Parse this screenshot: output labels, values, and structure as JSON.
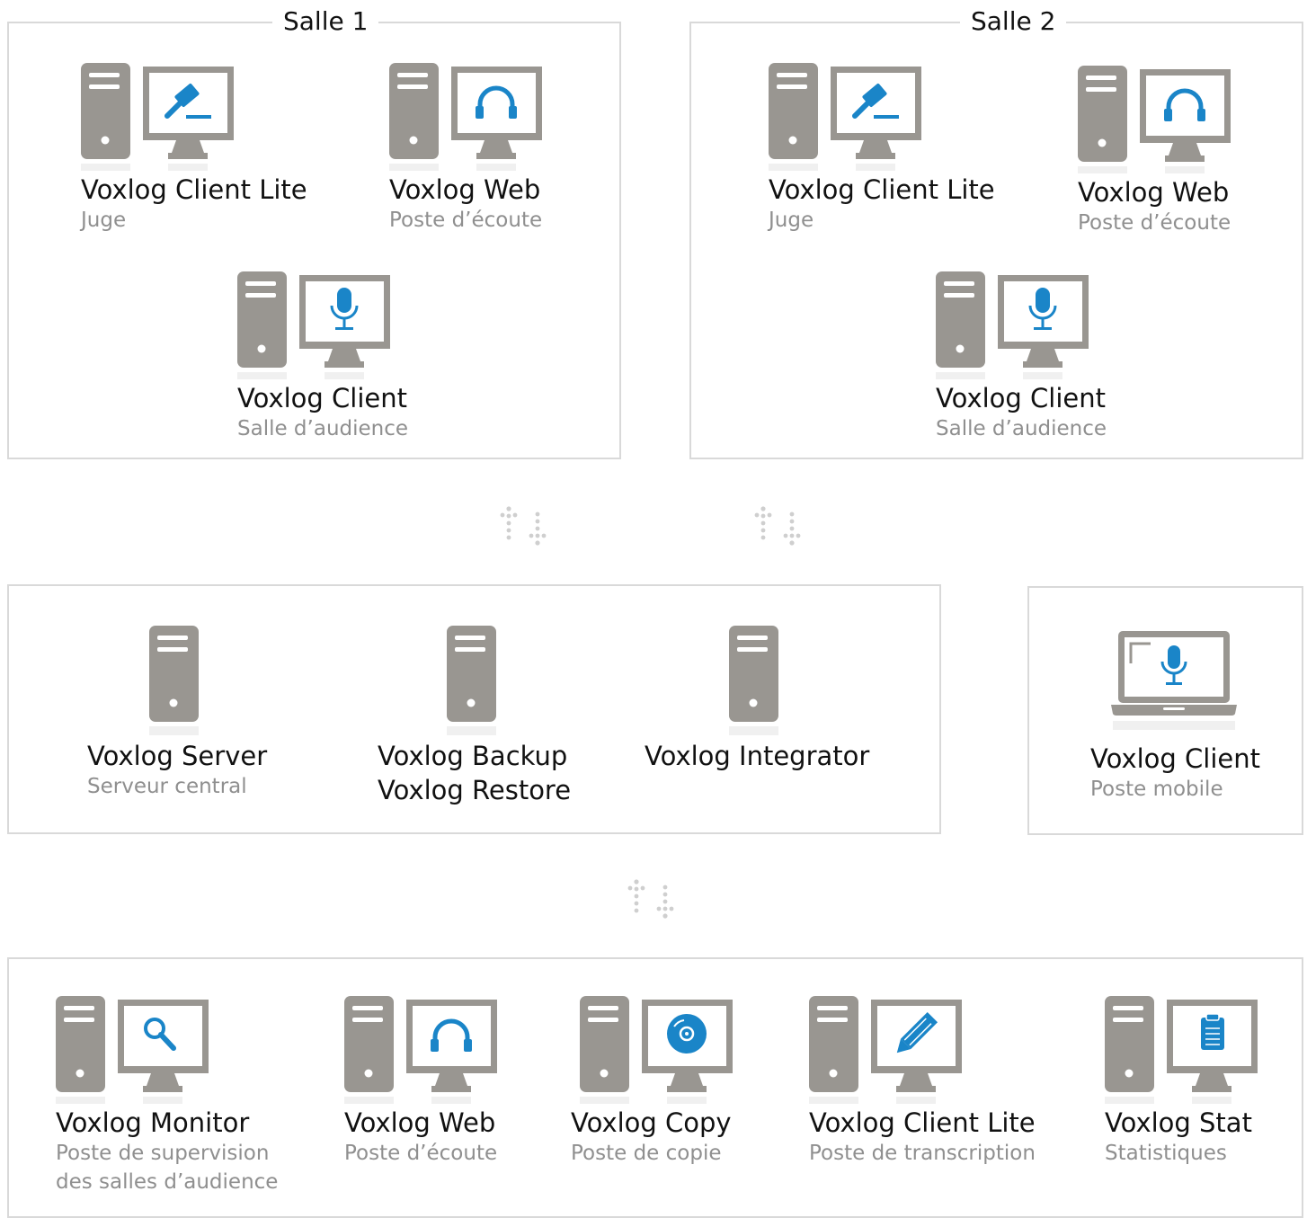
{
  "colors": {
    "device": "#999691",
    "accent": "#1a85c8",
    "border": "#d9d9d9",
    "reflection": "#f0f0f0"
  },
  "rooms": [
    {
      "title": "Salle 1"
    },
    {
      "title": "Salle 2"
    }
  ],
  "salle1": {
    "lite": {
      "name": "Voxlog Client Lite",
      "role": "Juge",
      "icon": "gavel-icon"
    },
    "web": {
      "name": "Voxlog Web",
      "role": "Poste d’écoute",
      "icon": "headphones-icon"
    },
    "client": {
      "name": "Voxlog Client",
      "role": "Salle d’audience",
      "icon": "microphone-icon"
    }
  },
  "salle2": {
    "lite": {
      "name": "Voxlog Client Lite",
      "role": "Juge",
      "icon": "gavel-icon"
    },
    "web": {
      "name": "Voxlog Web",
      "role": "Poste d’écoute",
      "icon": "headphones-icon"
    },
    "client": {
      "name": "Voxlog Client",
      "role": "Salle d’audience",
      "icon": "microphone-icon"
    }
  },
  "servers": {
    "server": {
      "name": "Voxlog Server",
      "role": "Serveur central"
    },
    "backup": {
      "name": "Voxlog Backup",
      "name2": "Voxlog Restore"
    },
    "integrator": {
      "name": "Voxlog Integrator"
    }
  },
  "mobile": {
    "name": "Voxlog Client",
    "role": "Poste mobile",
    "icon": "microphone-icon"
  },
  "bottom": {
    "monitor": {
      "name": "Voxlog Monitor",
      "role": "Poste de supervision",
      "role2": "des salles d’audience",
      "icon": "magnifier-icon"
    },
    "web": {
      "name": "Voxlog Web",
      "role": "Poste d’écoute",
      "icon": "headphones-icon"
    },
    "copy": {
      "name": "Voxlog Copy",
      "role": "Poste de copie",
      "icon": "disc-icon"
    },
    "lite": {
      "name": "Voxlog Client Lite",
      "role": "Poste de transcription",
      "icon": "pencil-icon"
    },
    "stat": {
      "name": "Voxlog Stat",
      "role": "Statistiques",
      "icon": "clipboard-icon"
    }
  }
}
